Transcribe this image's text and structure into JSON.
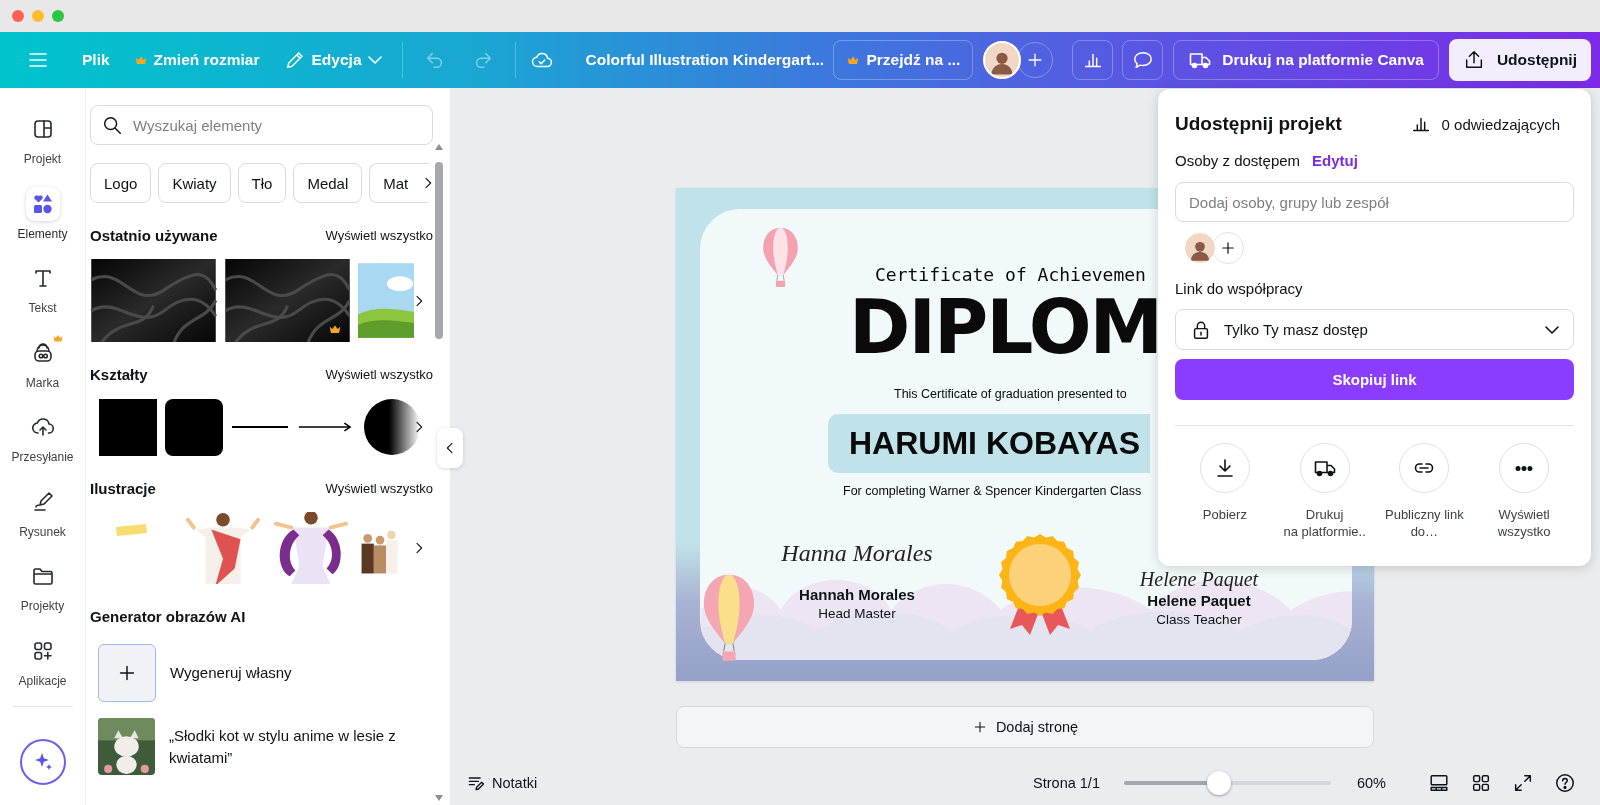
{
  "toolbar": {
    "file_menu": "Plik",
    "resize_button": {
      "label": "Zmień rozmiar",
      "premium": true
    },
    "edit_menu": "Edycja",
    "document_title": "Colorful Illustration Kindergart...",
    "upgrade_button": {
      "label": "Przejdź na ...",
      "premium": true
    },
    "print_button": "Drukuj na platformie Canva",
    "share_button": "Udostępnij"
  },
  "rail": [
    {
      "label": "Projekt",
      "selected": false,
      "premium": false
    },
    {
      "label": "Elementy",
      "selected": true,
      "premium": false
    },
    {
      "label": "Tekst",
      "selected": false,
      "premium": false
    },
    {
      "label": "Marka",
      "selected": false,
      "premium": true
    },
    {
      "label": "Przesyłanie",
      "selected": false,
      "premium": false
    },
    {
      "label": "Rysunek",
      "selected": false,
      "premium": false
    },
    {
      "label": "Projekty",
      "selected": false,
      "premium": false
    },
    {
      "label": "Aplikacje",
      "selected": false,
      "premium": false
    }
  ],
  "panel": {
    "search": {
      "placeholder": "Wyszukaj elementy"
    },
    "chips": [
      "Logo",
      "Kwiaty",
      "Tło",
      "Medal",
      "Mat"
    ],
    "sections": [
      {
        "kind": "recent",
        "title": "Ostatnio używane",
        "link": "Wyświetl wszystko",
        "thumbnails": [
          {
            "premium": false
          },
          {
            "premium": true
          },
          {
            "premium": false
          }
        ]
      },
      {
        "kind": "shapes",
        "title": "Kształty",
        "link": "Wyświetl wszystko"
      },
      {
        "kind": "illustrations",
        "title": "Ilustracje",
        "link": "Wyświetl wszystko"
      }
    ],
    "ai_generator": {
      "title": "Generator obrazów AI",
      "items": [
        {
          "kind": "create",
          "label": "Wygeneruj własny"
        },
        {
          "kind": "prompt",
          "label": "„Słodki kot w stylu anime w lesie z kwiatami”"
        }
      ]
    }
  },
  "certificate": {
    "heading": "Certificate of Achievemen",
    "title": "DIPLOM",
    "intro": "This Certificate of graduation presented to",
    "recipient": "HARUMI KOBAYAS",
    "reason": "For completing Warner & Spencer Kindergarten Class",
    "signers": [
      {
        "signature": "Hanna Morales",
        "name": "Hannah Morales",
        "role": "Head Master"
      },
      {
        "signature": "Helene Paquet",
        "name": "Helene Paquet",
        "role": "Class Teacher"
      }
    ]
  },
  "add_page_button": "Dodaj stronę",
  "status_bar": {
    "notes_button": "Notatki",
    "page": "Strona 1/1",
    "zoom": {
      "level": 0.46
    },
    "zoom_reading": "60%"
  },
  "share_panel": {
    "title": "Udostępnij projekt",
    "visitors": "0 odwiedzających",
    "access_label": "Osoby z dostępem",
    "edit_link": "Edytuj",
    "people_field": {
      "placeholder": "Dodaj osoby, grupy lub zespół"
    },
    "link_label": "Link do współpracy",
    "access_dropdown": {
      "value": "Tylko Ty masz dostęp"
    },
    "copy_button": "Skopiuj link",
    "actions": [
      {
        "kind": "download",
        "label": "Pobierz"
      },
      {
        "kind": "print",
        "label": "Drukuj\nna platformie.."
      },
      {
        "kind": "public_link",
        "label": "Publiczny link\ndo…"
      },
      {
        "kind": "more",
        "label": "Wyświetl\nwszystko"
      }
    ]
  }
}
